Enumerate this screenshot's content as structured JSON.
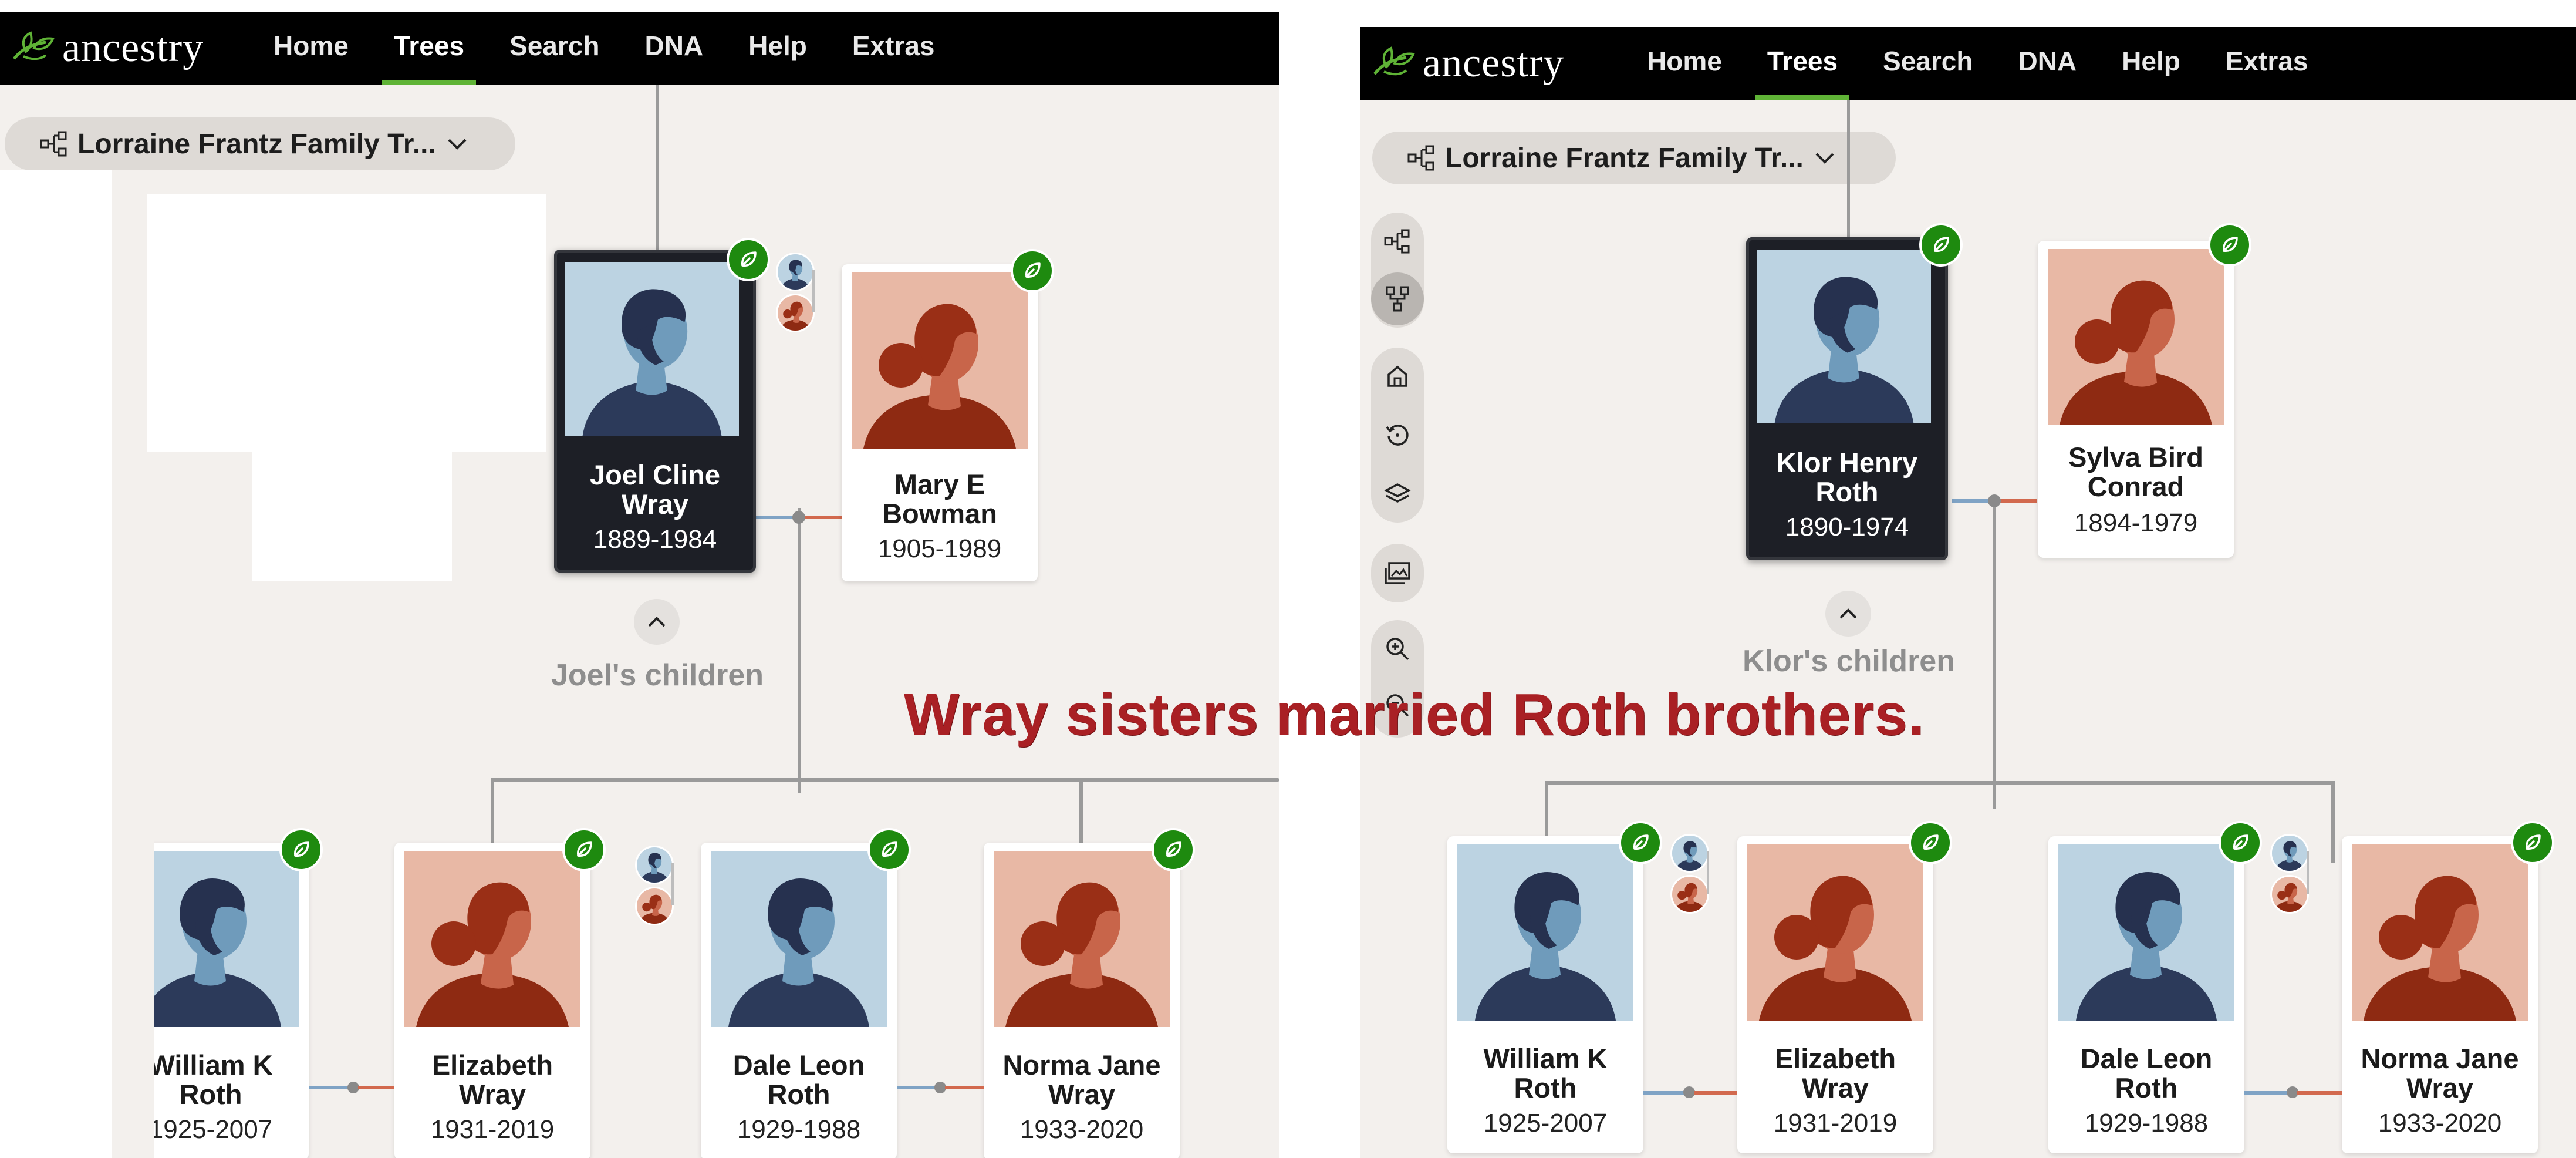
{
  "overlay_caption": "Wray sisters married Roth brothers.",
  "colors": {
    "header_bg": "#000000",
    "accent_green": "#5fb336",
    "leaf_badge": "#1e8a0f",
    "male_avatar_bg": "#bcd3e2",
    "female_avatar_bg": "#e8b8a5",
    "father_line": "#7fa3c5",
    "mother_line": "#d2694e",
    "caption": "#a92024"
  },
  "left": {
    "app": {
      "logo": "ancestry",
      "nav": [
        "Home",
        "Trees",
        "Search",
        "DNA",
        "Help",
        "Extras"
      ],
      "active_nav": "Trees"
    },
    "tree_selector": {
      "label": "Lorraine Frantz Family Tr...",
      "icon": "tree-view-icon",
      "chevron": "chevron-down-icon"
    },
    "parents": [
      {
        "name": "Joel Cline Wray",
        "dates": "1889-1984",
        "gender": "male",
        "focused": true
      },
      {
        "name": "Mary E Bowman",
        "dates": "1905-1989",
        "gender": "female",
        "focused": false
      }
    ],
    "children_label": "Joel's children",
    "children": [
      {
        "name": "William K Roth",
        "dates": "1925-2007",
        "gender": "male"
      },
      {
        "name": "Elizabeth Wray",
        "dates": "1931-2019",
        "gender": "female"
      },
      {
        "name": "Dale Leon Roth",
        "dates": "1929-1988",
        "gender": "male"
      },
      {
        "name": "Norma Jane Wray",
        "dates": "1933-2020",
        "gender": "female"
      }
    ]
  },
  "right": {
    "app": {
      "logo": "ancestry",
      "nav": [
        "Home",
        "Trees",
        "Search",
        "DNA",
        "Help",
        "Extras"
      ],
      "active_nav": "Trees"
    },
    "tree_selector": {
      "label": "Lorraine Frantz Family Tr...",
      "icon": "tree-view-icon",
      "chevron": "chevron-down-icon"
    },
    "toolbar_icons": [
      "tree-view-icon",
      "family-view-icon",
      "home-icon",
      "history-icon",
      "layers-icon",
      "media-gallery-icon",
      "zoom-in-icon",
      "zoom-out-icon"
    ],
    "parents": [
      {
        "name": "Klor Henry Roth",
        "dates": "1890-1974",
        "gender": "male",
        "focused": true
      },
      {
        "name": "Sylva Bird Conrad",
        "dates": "1894-1979",
        "gender": "female",
        "focused": false
      }
    ],
    "children_label": "Klor's children",
    "children": [
      {
        "name": "William K Roth",
        "dates": "1925-2007",
        "gender": "male"
      },
      {
        "name": "Elizabeth Wray",
        "dates": "1931-2019",
        "gender": "female"
      },
      {
        "name": "Dale Leon Roth",
        "dates": "1929-1988",
        "gender": "male"
      },
      {
        "name": "Norma Jane Wray",
        "dates": "1933-2020",
        "gender": "female"
      }
    ]
  }
}
